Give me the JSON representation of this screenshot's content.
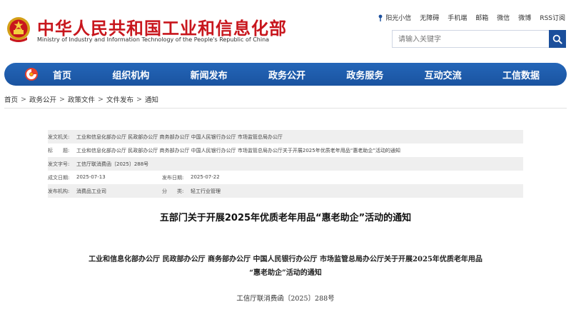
{
  "header": {
    "title": "中华人民共和国工业和信息化部",
    "subtitle": "Ministry of Industry and Information Technology of the People's Republic of China",
    "top_links": [
      {
        "label": "阳光小信",
        "icon": "sunshine-icon"
      },
      {
        "label": "无障碍",
        "icon": ""
      },
      {
        "label": "手机端",
        "icon": ""
      },
      {
        "label": "邮箱",
        "icon": ""
      },
      {
        "label": "微信",
        "icon": ""
      },
      {
        "label": "微博",
        "icon": ""
      },
      {
        "label": "RSS订阅",
        "icon": ""
      }
    ],
    "search_placeholder": "请输入关键字"
  },
  "nav": {
    "items": [
      "首页",
      "组织机构",
      "新闻发布",
      "政务公开",
      "政务服务",
      "互动交流",
      "工信数据"
    ]
  },
  "breadcrumb": [
    "首页",
    "政务公开",
    "政策文件",
    "文件发布",
    "通知"
  ],
  "info": {
    "issuer_label": "发文机关:",
    "issuer": "工业和信息化部办公厅 民政部办公厅 商务部办公厅 中国人民银行办公厅 市场监管总局办公厅",
    "title_label": "标　　题:",
    "title": "工业和信息化部办公厅 民政部办公厅 商务部办公厅 中国人民银行办公厅 市场监管总局办公厅关于开展2025年优质老年用品“惠老助企”活动的通知",
    "docno_label": "发文字号:",
    "docno": "工信厅联消费函〔2025〕288号",
    "created_label": "成文日期:",
    "created": "2025-07-13",
    "published_label": "发布日期:",
    "published": "2025-07-22",
    "org_label": "发布机构:",
    "org": "消费品工业司",
    "category_label": "分　　类:",
    "category": "轻工行业管理"
  },
  "article": {
    "title": "五部门关于开展2025年优质老年用品“惠老助企”活动的通知",
    "heading_line1": "工业和信息化部办公厅 民政部办公厅 商务部办公厅 中国人民银行办公厅 市场监管总局办公厅关于开展2025年优质老年用品",
    "heading_line2": "“惠老助企”活动的通知",
    "docno": "工信厅联消费函〔2025〕288号"
  },
  "colors": {
    "brand_red": "#c8161d",
    "nav_blue": "#1b4f9c",
    "table_shade": "#efefef"
  }
}
